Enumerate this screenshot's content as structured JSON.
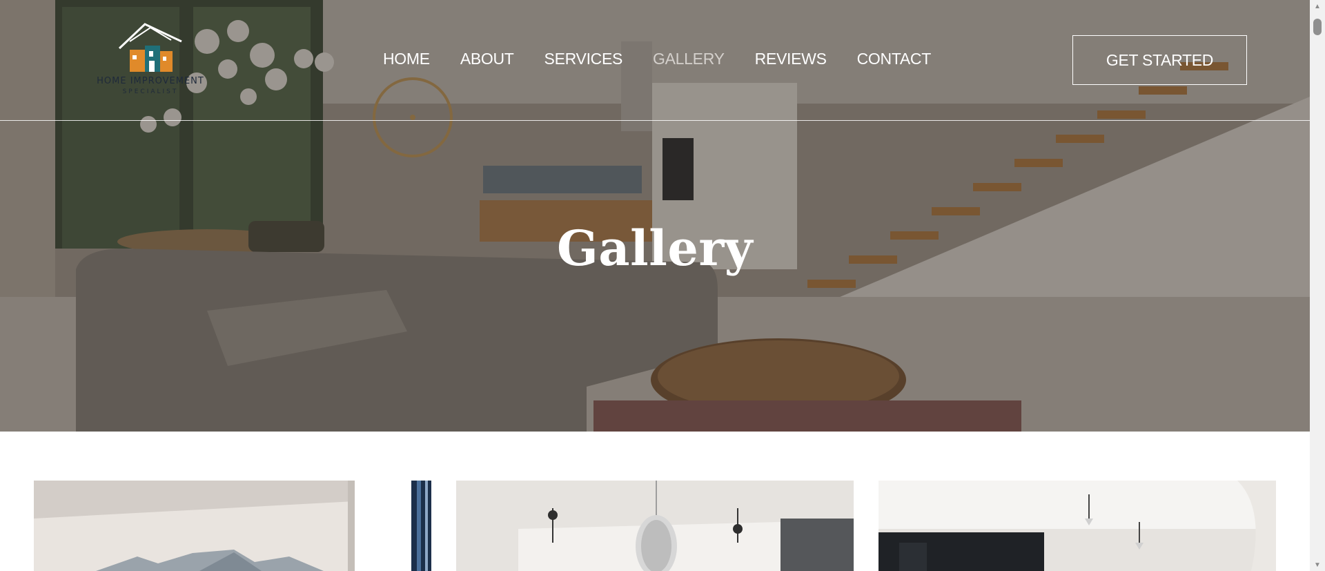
{
  "logo": {
    "name": "HOME IMPROVEMENT",
    "tagline": "SPECIALIST"
  },
  "nav": {
    "items": [
      {
        "label": "HOME",
        "active": false
      },
      {
        "label": "ABOUT",
        "active": false
      },
      {
        "label": "SERVICES",
        "active": false
      },
      {
        "label": "GALLERY",
        "active": true
      },
      {
        "label": "REVIEWS",
        "active": false
      },
      {
        "label": "CONTACT",
        "active": false
      }
    ],
    "cta_label": "GET STARTED"
  },
  "hero": {
    "title": "Gallery"
  },
  "gallery": {
    "images": [
      {
        "subject": "living room with mountain mural"
      },
      {
        "subject": "window frame"
      },
      {
        "subject": "room with crystal chandelier"
      },
      {
        "subject": "kitchen with pendant lights"
      }
    ]
  },
  "colors": {
    "overlay": "#2a2522",
    "text_light": "#ffffff",
    "logo_text": "#1f2a3a",
    "logo_orange": "#e08a2a",
    "logo_teal": "#1f6f78"
  }
}
